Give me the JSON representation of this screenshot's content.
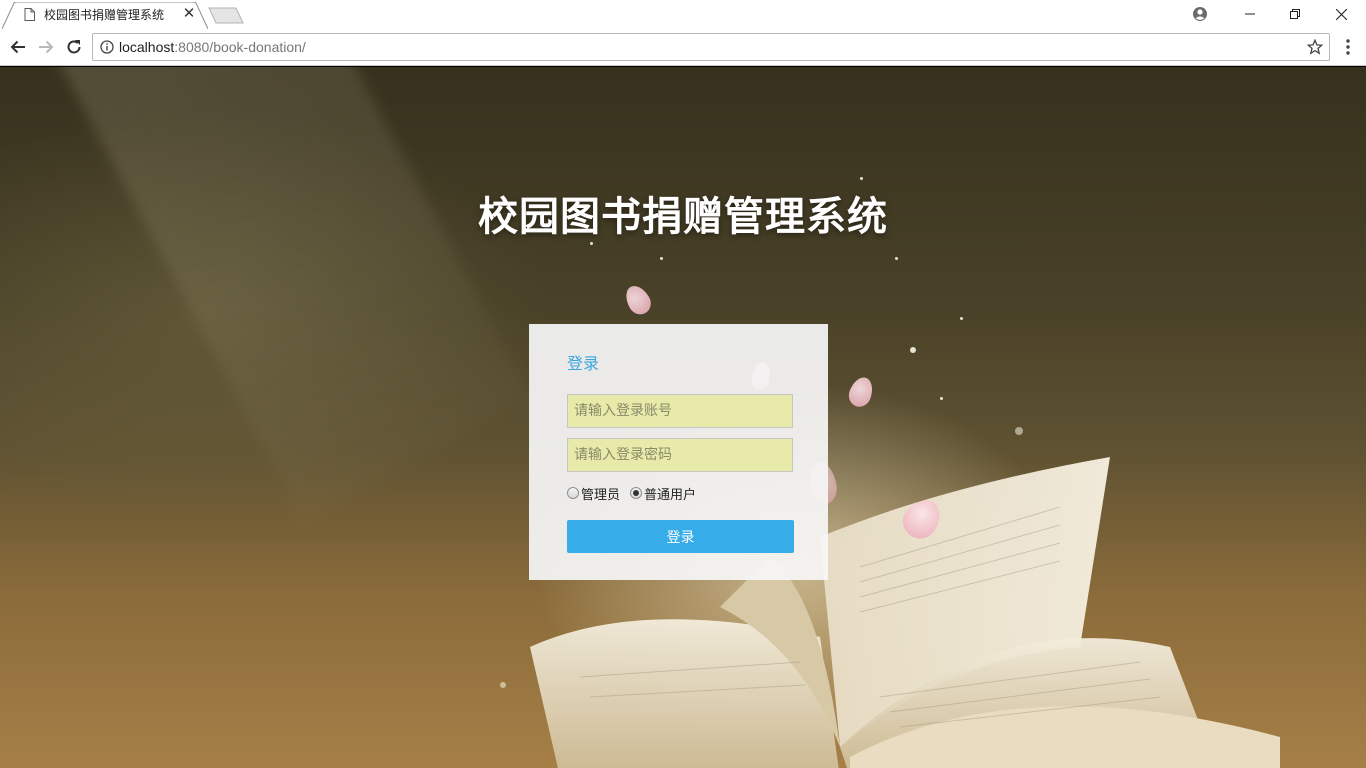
{
  "browser": {
    "tab_title": "校园图书捐赠管理系统",
    "tab_close": "✕",
    "url_host": "localhost",
    "url_rest": ":8080/book-donation/"
  },
  "page": {
    "site_title": "校园图书捐赠管理系统",
    "login": {
      "heading": "登录",
      "username_placeholder": "请输入登录账号",
      "password_placeholder": "请输入登录密码",
      "roles": [
        {
          "label": "管理员",
          "checked": false
        },
        {
          "label": "普通用户",
          "checked": true
        }
      ],
      "submit_label": "登录"
    }
  },
  "colors": {
    "accent": "#36ace8",
    "heading": "#3aa7e0",
    "field_bg": "#e8eaa9"
  }
}
